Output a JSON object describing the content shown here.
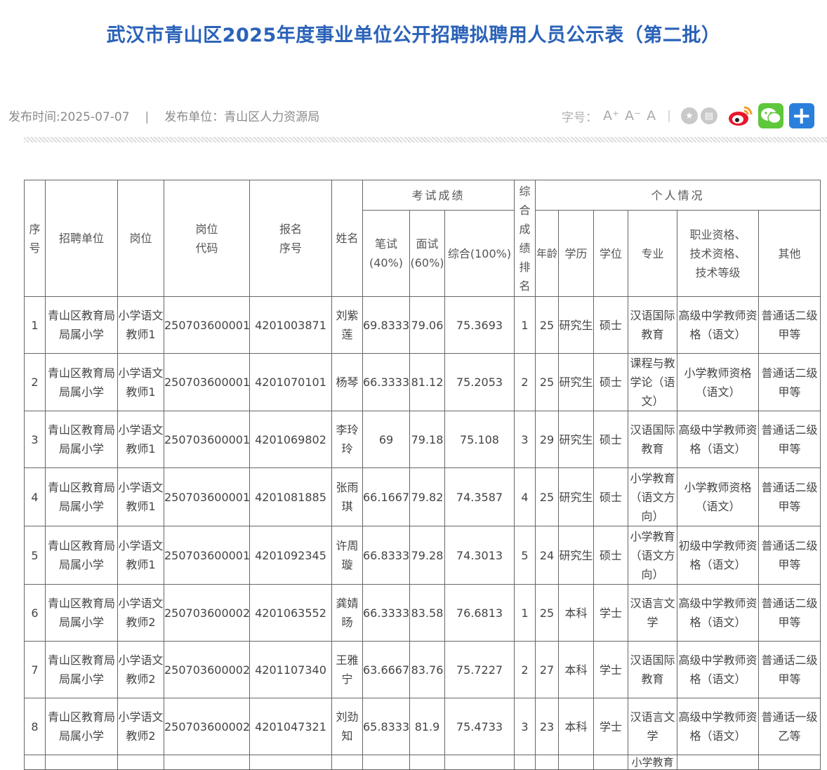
{
  "title": "武汉市青山区2025年度事业单位公开招聘拟聘用人员公示表（第二批）",
  "meta": {
    "publish_time": "发布时间:2025-07-07",
    "separator": "|",
    "publisher": "发布单位：青山区人力资源局"
  },
  "tools": {
    "font_size_label": "字号：",
    "font_large": "A⁺",
    "font_small": "A⁻",
    "font_normal": "A",
    "separator": "|",
    "icons": [
      "star-icon",
      "print-icon",
      "weibo-icon",
      "wechat-icon",
      "plus-share-icon"
    ]
  },
  "table": {
    "headers": {
      "index": "序号",
      "unit": "招聘单位",
      "post": "岗位",
      "post_code": "岗位代码",
      "reg_no": "报名序号",
      "name": "姓名",
      "exam": "考试成绩",
      "written": "笔试(40%)",
      "interview": "面试(60%)",
      "total": "综合(100%)",
      "rank": "综合成绩排名",
      "personal": "个人情况",
      "age": "年龄",
      "education": "学历",
      "degree": "学位",
      "major": "专业",
      "qualification": "职业资格、技术资格、技术等级",
      "other": "其他"
    },
    "rows": [
      {
        "index": "1",
        "unit": "青山区教育局局属小学",
        "post": "小学语文教师1",
        "post_code": "250703600001",
        "reg_no": "4201003871",
        "name": "刘紫莲",
        "written": "69.8333",
        "interview": "79.06",
        "total": "75.3693",
        "rank": "1",
        "age": "25",
        "education": "研究生",
        "degree": "硕士",
        "major": "汉语国际教育",
        "qualification": "高级中学教师资格（语文）",
        "other": "普通话二级甲等"
      },
      {
        "index": "2",
        "unit": "青山区教育局局属小学",
        "post": "小学语文教师1",
        "post_code": "250703600001",
        "reg_no": "4201070101",
        "name": "杨琴",
        "written": "66.3333",
        "interview": "81.12",
        "total": "75.2053",
        "rank": "2",
        "age": "25",
        "education": "研究生",
        "degree": "硕士",
        "major": "课程与教学论（语文）",
        "qualification": "小学教师资格（语文）",
        "other": "普通话二级甲等"
      },
      {
        "index": "3",
        "unit": "青山区教育局局属小学",
        "post": "小学语文教师1",
        "post_code": "250703600001",
        "reg_no": "4201069802",
        "name": "李玲玲",
        "written": "69",
        "interview": "79.18",
        "total": "75.108",
        "rank": "3",
        "age": "29",
        "education": "研究生",
        "degree": "硕士",
        "major": "汉语国际教育",
        "qualification": "高级中学教师资格（语文）",
        "other": "普通话二级甲等"
      },
      {
        "index": "4",
        "unit": "青山区教育局局属小学",
        "post": "小学语文教师1",
        "post_code": "250703600001",
        "reg_no": "4201081885",
        "name": "张雨琪",
        "written": "66.1667",
        "interview": "79.82",
        "total": "74.3587",
        "rank": "4",
        "age": "25",
        "education": "研究生",
        "degree": "硕士",
        "major": "小学教育（语文方向）",
        "qualification": "小学教师资格（语文）",
        "other": "普通话二级甲等"
      },
      {
        "index": "5",
        "unit": "青山区教育局局属小学",
        "post": "小学语文教师1",
        "post_code": "250703600001",
        "reg_no": "4201092345",
        "name": "许周璇",
        "written": "66.8333",
        "interview": "79.28",
        "total": "74.3013",
        "rank": "5",
        "age": "24",
        "education": "研究生",
        "degree": "硕士",
        "major": "小学教育（语文方向）",
        "qualification": "初级中学教师资格（语文）",
        "other": "普通话二级甲等"
      },
      {
        "index": "6",
        "unit": "青山区教育局局属小学",
        "post": "小学语文教师2",
        "post_code": "250703600002",
        "reg_no": "4201063552",
        "name": "龚婧旸",
        "written": "66.3333",
        "interview": "83.58",
        "total": "76.6813",
        "rank": "1",
        "age": "25",
        "education": "本科",
        "degree": "学士",
        "major": "汉语言文学",
        "qualification": "高级中学教师资格（语文）",
        "other": "普通话二级甲等"
      },
      {
        "index": "7",
        "unit": "青山区教育局局属小学",
        "post": "小学语文教师2",
        "post_code": "250703600002",
        "reg_no": "4201107340",
        "name": "王雅宁",
        "written": "63.6667",
        "interview": "83.76",
        "total": "75.7227",
        "rank": "2",
        "age": "27",
        "education": "本科",
        "degree": "学士",
        "major": "汉语国际教育",
        "qualification": "高级中学教师资格（语文）",
        "other": "普通话二级甲等"
      },
      {
        "index": "8",
        "unit": "青山区教育局局属小学",
        "post": "小学语文教师2",
        "post_code": "250703600002",
        "reg_no": "4201047321",
        "name": "刘劲知",
        "written": "65.8333",
        "interview": "81.9",
        "total": "75.4733",
        "rank": "3",
        "age": "23",
        "education": "本科",
        "degree": "学士",
        "major": "汉语言文学",
        "qualification": "高级中学教师资格（语文）",
        "other": "普通话一级乙等"
      },
      {
        "major": "小学教育"
      }
    ]
  },
  "colors": {
    "title": "#2a62b8",
    "wechat": "#5ec73a",
    "weibo": "#e6162d",
    "plus": "#2a7fdc"
  }
}
